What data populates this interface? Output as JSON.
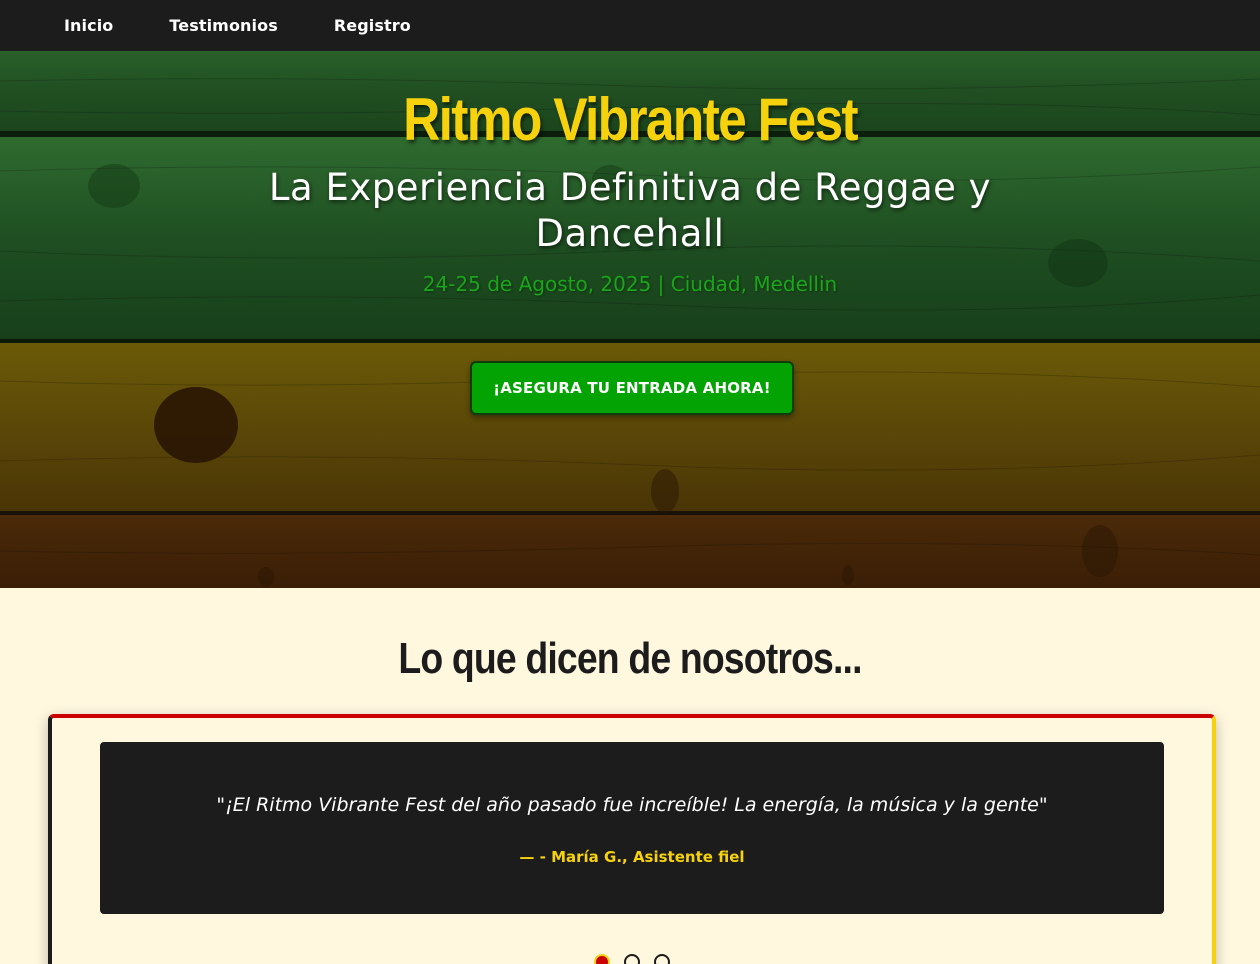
{
  "nav": {
    "items": [
      {
        "label": "Inicio"
      },
      {
        "label": "Testimonios"
      },
      {
        "label": "Registro"
      }
    ]
  },
  "hero": {
    "title": "Ritmo Vibrante Fest",
    "subtitle": "La Experiencia Definitiva de Reggae y Dancehall",
    "date_location": "24-25 de Agosto, 2025 | Ciudad, Medellin",
    "cta_label": "¡ASEGURA TU ENTRADA AHORA!"
  },
  "testimonials": {
    "heading": "Lo que dicen de nosotros...",
    "slides": [
      {
        "quote": "\"¡El Ritmo Vibrante Fest del año pasado fue increíble! La energía, la música y la gente\"",
        "author": "— - María G., Asistente fiel"
      }
    ],
    "active_index": 0,
    "slide_count": 3
  },
  "colors": {
    "nav_bg": "#1c1c1c",
    "green": "#03a303",
    "yellow": "#f6d20d",
    "red": "#cc0000",
    "page_bg": "#fff8df"
  }
}
